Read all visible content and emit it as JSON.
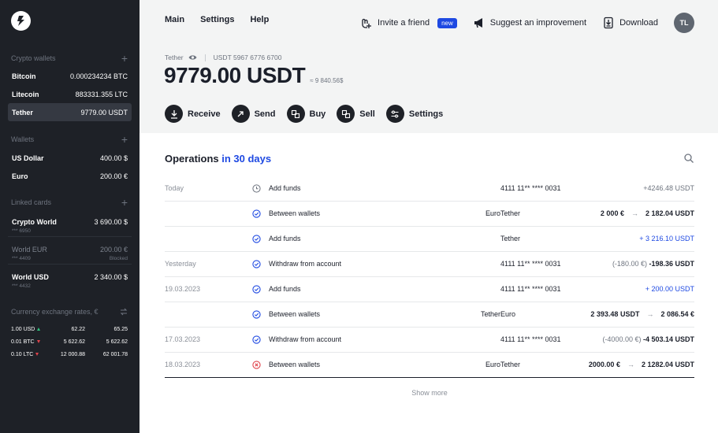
{
  "sidebar": {
    "crypto_wallets": {
      "heading": "Crypto wallets",
      "items": [
        {
          "name": "Bitcoin",
          "value": "0.000234234 BTC"
        },
        {
          "name": "Litecoin",
          "value": "883331.355 LTC"
        },
        {
          "name": "Tether",
          "value": "9779.00 USDT"
        }
      ]
    },
    "wallets": {
      "heading": "Wallets",
      "items": [
        {
          "name": "US Dollar",
          "value": "400.00 $"
        },
        {
          "name": "Euro",
          "value": "200.00 €"
        }
      ]
    },
    "linked_cards": {
      "heading": "Linked cards",
      "items": [
        {
          "name": "Crypto World",
          "value": "3 690.00 $",
          "number": "*** 6950",
          "status": ""
        },
        {
          "name": "World EUR",
          "value": "200.00 €",
          "number": "*** 4409",
          "status": "Blocked"
        },
        {
          "name": "World USD",
          "value": "2 340.00 $",
          "number": "*** 4432",
          "status": ""
        }
      ]
    },
    "rates": {
      "heading": "Currency exchange rates, €",
      "rows": [
        {
          "pair": "1.00 USD",
          "dir": "up",
          "buy": "62.22",
          "sell": "65.25"
        },
        {
          "pair": "0.01 BTC",
          "dir": "down",
          "buy": "5 622.62",
          "sell": "5 622.62"
        },
        {
          "pair": "0.10 LTC",
          "dir": "down",
          "buy": "12 000.88",
          "sell": "62 001.78"
        }
      ]
    }
  },
  "nav": {
    "main": "Main",
    "settings": "Settings",
    "help": "Help"
  },
  "top_actions": {
    "invite": "Invite a friend",
    "new_badge": "new",
    "suggest": "Suggest an improvement",
    "download": "Download",
    "avatar": "TL"
  },
  "account": {
    "name": "Tether",
    "number": "USDT 5967 6776 6700",
    "balance": "9779.00 USDT",
    "approx": "≈ 9 840.56$"
  },
  "actions": {
    "receive": "Receive",
    "send": "Send",
    "buy": "Buy",
    "sell": "Sell",
    "settings": "Settings"
  },
  "operations": {
    "title": "Operations",
    "period": "in 30 days",
    "show_more": "Show more",
    "rows": [
      {
        "date": "Today",
        "status": "pending",
        "desc": "Add funds",
        "from": "",
        "to": "4111 11** **** 0031",
        "amount": "",
        "amount_main": "+4246.48 USDT",
        "style": "muted"
      },
      {
        "date": "",
        "status": "done",
        "desc": "Between wallets",
        "from": "Euro",
        "to": "Tether",
        "amount": "2 000 €",
        "amount_main": "2 182.04 USDT",
        "style": "bold"
      },
      {
        "date": "",
        "status": "done",
        "desc": "Add funds",
        "from": "",
        "to": "Tether",
        "amount": "",
        "amount_main": "+ 3 216.10 USDT",
        "style": "in"
      },
      {
        "date": "Yesterday",
        "status": "done",
        "desc": "Withdraw from account",
        "from": "",
        "to": "4111 11** **** 0031",
        "amount": "(-180.00 €)",
        "amount_main": "-198.36 USDT",
        "style": "paren"
      },
      {
        "date": "19.03.2023",
        "status": "done",
        "desc": "Add funds",
        "from": "",
        "to": "4111 11** **** 0031",
        "amount": "",
        "amount_main": "+ 200.00 USDT",
        "style": "in"
      },
      {
        "date": "",
        "status": "done",
        "desc": "Between wallets",
        "from": "Tether",
        "to": "Euro",
        "amount": "2 393.48 USDT",
        "amount_main": "2 086.54 €",
        "style": "bold"
      },
      {
        "date": "17.03.2023",
        "status": "done",
        "desc": "Withdraw from account",
        "from": "",
        "to": "4111 11** **** 0031",
        "amount": "(-4000.00 €)",
        "amount_main": "-4 503.14 USDT",
        "style": "paren"
      },
      {
        "date": "18.03.2023",
        "status": "failed",
        "desc": "Between wallets",
        "from": "Euro",
        "to": "Tether",
        "amount": "2000.00 €",
        "amount_main": "2 1282.04 USDT",
        "style": "bold"
      }
    ]
  },
  "colors": {
    "accent": "#1e49e2",
    "sidebar_bg": "#1e2127",
    "success": "#2ec27e",
    "danger": "#e0434b"
  }
}
